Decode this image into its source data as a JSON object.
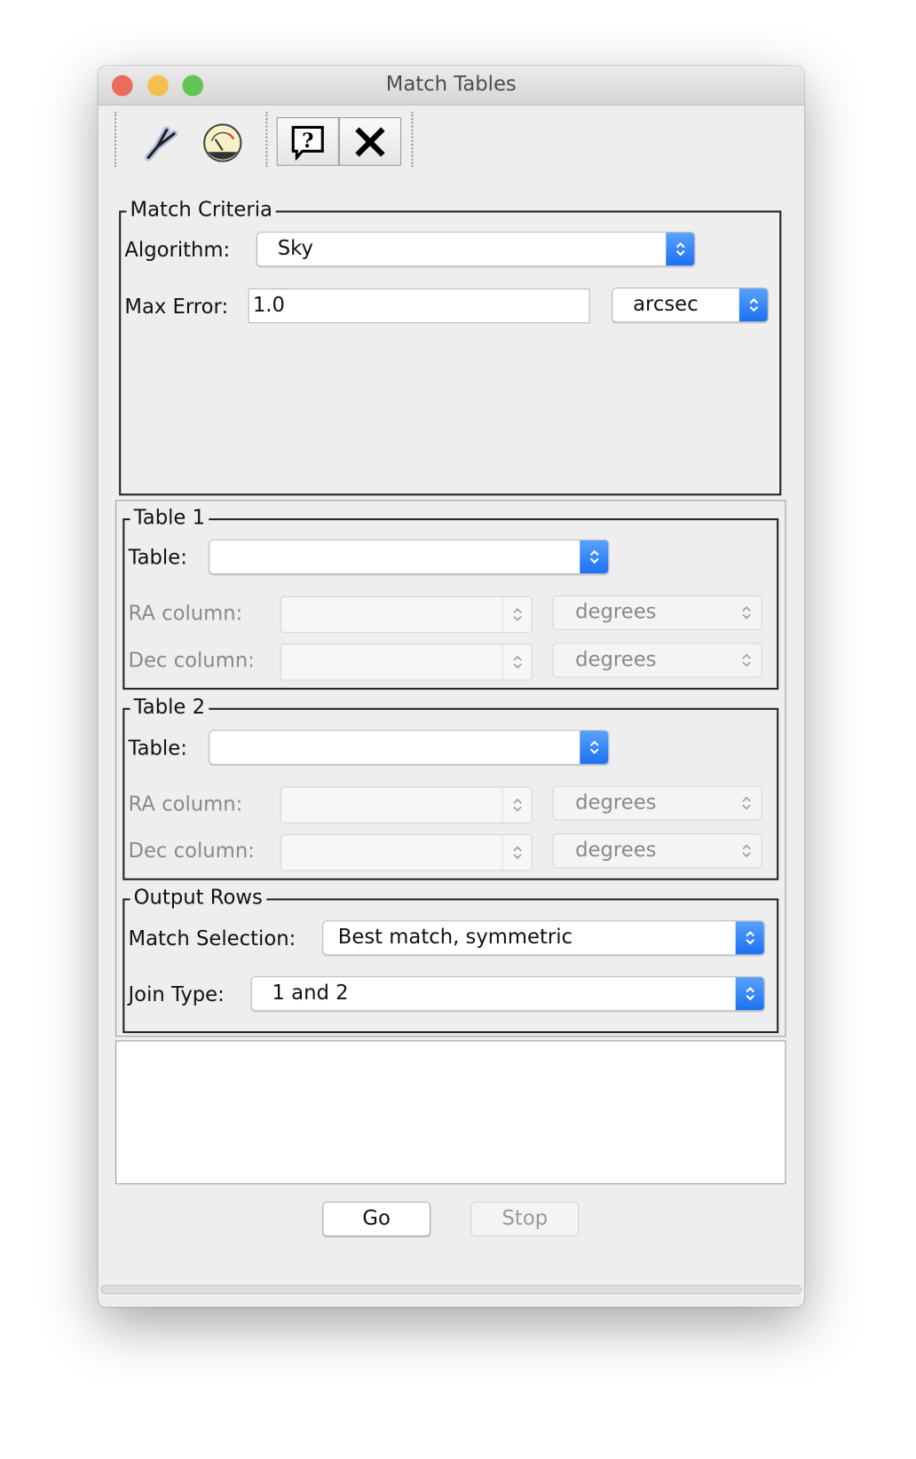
{
  "window": {
    "title": "Match Tables"
  },
  "toolbar": {
    "icons": [
      "tuning-fork-icon",
      "gauge-icon",
      "help-icon",
      "close-icon"
    ]
  },
  "match_criteria": {
    "legend": "Match Criteria",
    "algorithm_label": "Algorithm:",
    "algorithm_value": "Sky",
    "max_error_label": "Max Error:",
    "max_error_value": "1.0",
    "max_error_unit": "arcsec"
  },
  "table1": {
    "legend": "Table 1",
    "table_label": "Table:",
    "table_value": "",
    "ra_label": "RA column:",
    "ra_unit": "degrees",
    "dec_label": "Dec column:",
    "dec_unit": "degrees"
  },
  "table2": {
    "legend": "Table 2",
    "table_label": "Table:",
    "table_value": "",
    "ra_label": "RA column:",
    "ra_unit": "degrees",
    "dec_label": "Dec column:",
    "dec_unit": "degrees"
  },
  "output": {
    "legend": "Output Rows",
    "match_selection_label": "Match Selection:",
    "match_selection_value": "Best match, symmetric",
    "join_type_label": "Join Type:",
    "join_type_value": "1 and 2"
  },
  "actions": {
    "go": "Go",
    "stop": "Stop"
  },
  "progress": {
    "value": 0
  },
  "colors": {
    "accent": "#1b6ff3",
    "close": "#ed6a5e",
    "minimize": "#f5bf4f",
    "zoom": "#61c554"
  }
}
